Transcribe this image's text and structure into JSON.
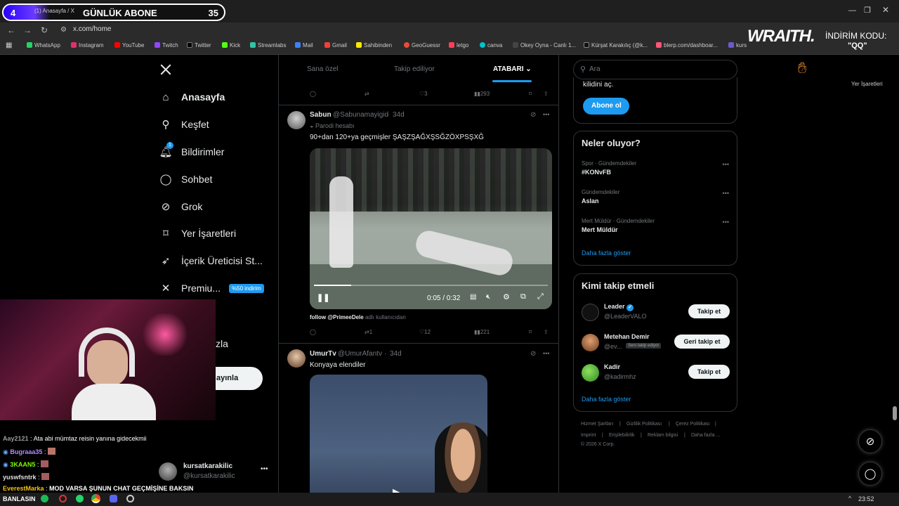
{
  "browser": {
    "tab_number": "4",
    "tab_title": "(1) Anasayfa / X",
    "overlay_title": "GÜNLÜK ABONE",
    "overlay_count": "35",
    "overlay_progress": 0.35,
    "url": "x.com/home",
    "bookmarks": [
      "WhatsApp",
      "Instagram",
      "YouTube",
      "Twitch",
      "Twitter",
      "Kick",
      "Streamlabs",
      "Mail",
      "Gmail",
      "Sahibinden",
      "GeoGuessr",
      "letgo",
      "canva",
      "Okey Oyna - Canlı 1...",
      "Kürşat Karakılıç (@k...",
      "blerp.com/dashboar...",
      "kurs"
    ],
    "bookmarks_other": "Yer İşaretleri"
  },
  "sponsor": {
    "logo": "WRAITH.",
    "discount_label": "İNDİRİM KODU:",
    "code": "\"QQ\""
  },
  "sidebar": {
    "items": [
      {
        "label": "Anasayfa",
        "icon": "home-icon"
      },
      {
        "label": "Keşfet",
        "icon": "search-icon"
      },
      {
        "label": "Bildirimler",
        "icon": "bell-icon",
        "badge": "1"
      },
      {
        "label": "Sohbet",
        "icon": "chat-icon"
      },
      {
        "label": "Grok",
        "icon": "grok-icon"
      },
      {
        "label": "Yer İşaretleri",
        "icon": "bookmark-icon"
      },
      {
        "label": "İçerik Üreticisi St...",
        "icon": "rocket-icon"
      },
      {
        "label": "Premiu...",
        "icon": "x-icon",
        "badge": "%50 indirim"
      }
    ],
    "partial_more": "zla",
    "post_button": "ayınla",
    "account": {
      "name": "kursatkarakilic",
      "handle": "@kursatkarakilic"
    }
  },
  "feed": {
    "tabs": [
      "Sana özel",
      "Takip ediliyor",
      "ATABARI"
    ],
    "top_actions": {
      "likes": "3",
      "views": "293"
    },
    "tweets": [
      {
        "name": "Sabun",
        "handle": "@Sabunamayigid",
        "time": "34d",
        "label": "Parodi hesabı",
        "text": "90+dan 120+ya geçmişler ŞAŞZŞAĞXŞSĞZÖXPSŞXĞ",
        "video_time": "0:05 / 0:32",
        "video_progress": 0.16,
        "caption_link": "follow @PrimeeDele",
        "caption_rest": "adlı kullanıcıdan",
        "retweets": "1",
        "likes": "12",
        "views": "221"
      },
      {
        "name": "UmurTv",
        "handle": "@UmurAfantv",
        "time": "34d",
        "text": "Konyaya elendiler"
      }
    ]
  },
  "right": {
    "search_placeholder": "Ara",
    "premium_text": "kilidini aç.",
    "subscribe_button": "Abone ol",
    "trends_title": "Neler oluyor?",
    "trends": [
      {
        "category": "Spor · Gündemdekiler",
        "name": "#KONvFB"
      },
      {
        "category": "Gündemdekiler",
        "name": "Aslan"
      },
      {
        "category": "Mert Müldür · Gündemdekiler",
        "name": "Mert Müldür"
      }
    ],
    "show_more": "Daha fazla göster",
    "who_to_follow_title": "Kimi takip etmeli",
    "suggestions": [
      {
        "name": "Leader",
        "handle": "@LeaderVALO",
        "button": "Takip et",
        "verified": true
      },
      {
        "name": "Metehan Demir",
        "handle": "@ev...",
        "follows_you": "Seni takip ediyor",
        "button": "Geri takip et"
      },
      {
        "name": "Kadir",
        "handle": "@kadirmhz",
        "button": "Takip et"
      }
    ],
    "show_more_2": "Daha fazla göster",
    "footer": [
      "Hizmet Şartları",
      "Gizlilik Politikası",
      "Çerez Politikası",
      "Imprint",
      "Erişilebilirlik",
      "Reklam bilgisi",
      "Daha fazla ...",
      "© 2026 X Corp."
    ]
  },
  "chat": [
    {
      "user": "Aay2121",
      "msg": "Ata abi mümtaz reisin yanına gidecekmii",
      "color": "#9a9a9a"
    },
    {
      "user": "Bugraaa35",
      "msg": "",
      "color": "#b18cff"
    },
    {
      "user": "3KAAN5",
      "msg": "",
      "color": "#7CFC00"
    },
    {
      "user": "yuswfsntrk",
      "msg": "",
      "color": "#e0e0e0"
    },
    {
      "user": "EverestMarka",
      "msg": "MOD VARSA ŞUNUN CHAT GEÇMİŞİNE BAKSIN",
      "color": "#f1c40f"
    },
    {
      "user": "BANLASIN",
      "msg": "",
      "color": "#ffffff"
    }
  ],
  "taskbar": {
    "time": "23:52"
  }
}
